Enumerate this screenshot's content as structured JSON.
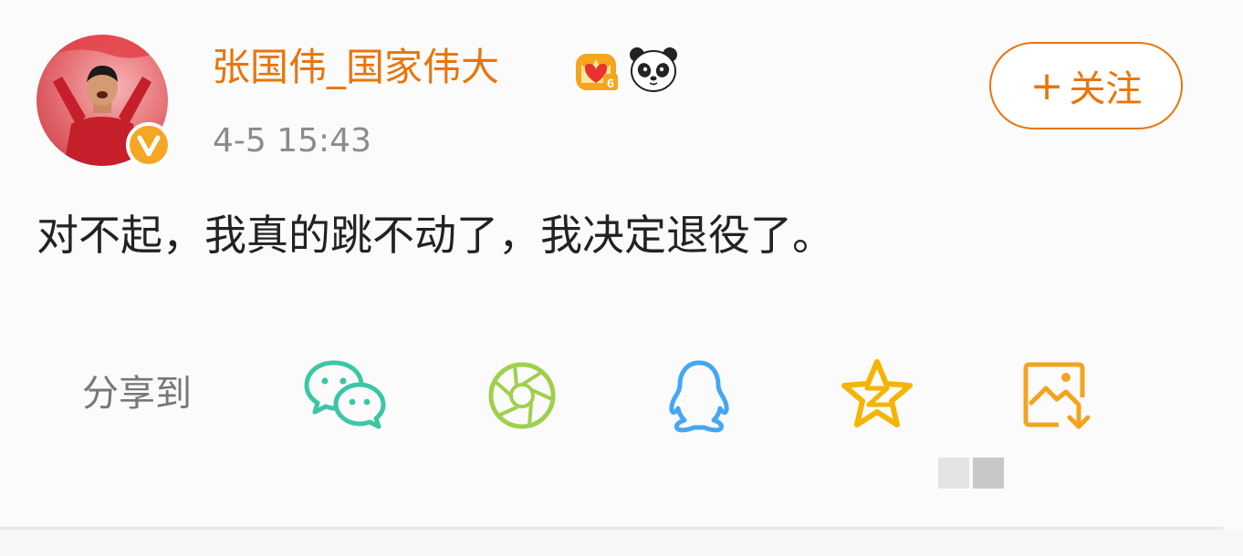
{
  "post": {
    "username": "张国伟_国家伟大",
    "timestamp": "4-5 15:43",
    "follow_plus": "+",
    "follow_label": "关注",
    "content": "对不起，我真的跳不动了，我决定退役了。",
    "crown_level": "6"
  },
  "share": {
    "label": "分享到",
    "targets": [
      {
        "icon": "wechat-icon",
        "color": "#3cc6a6"
      },
      {
        "icon": "moments-icon",
        "color": "#9fd04c"
      },
      {
        "icon": "qq-icon",
        "color": "#45a7f2"
      },
      {
        "icon": "qzone-icon",
        "color": "#f5b400"
      },
      {
        "icon": "save-image-icon",
        "color": "#f2a41f"
      }
    ]
  },
  "colors": {
    "accent": "#e8750a",
    "text": "#222222",
    "muted": "#8b8b8f"
  }
}
